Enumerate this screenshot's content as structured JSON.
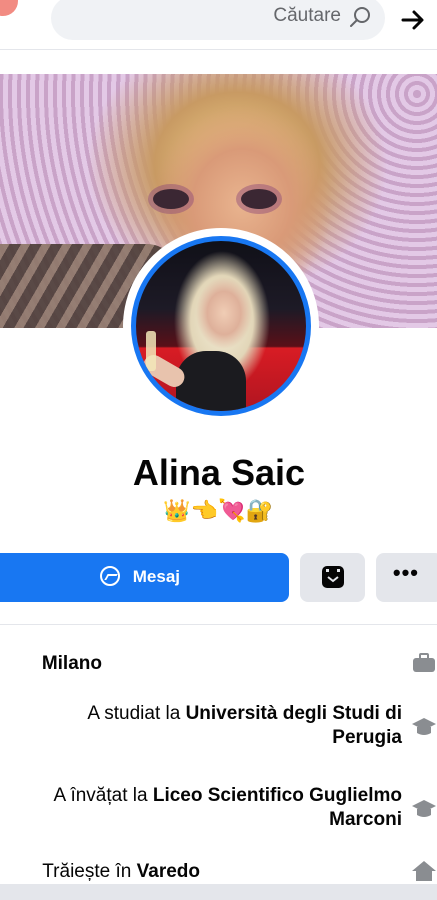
{
  "search": {
    "placeholder": "Căutare"
  },
  "profile": {
    "name": "Alina Saic",
    "bio_emojis": "👑👈💘🔐"
  },
  "actions": {
    "message_label": "Mesaj",
    "more_label": "•••"
  },
  "details": [
    {
      "icon": "briefcase-icon",
      "prefix": "",
      "bold": "Milano"
    },
    {
      "icon": "graduation-cap-icon",
      "prefix": "A studiat la ",
      "bold": "Università degli Studi di Perugia"
    },
    {
      "icon": "graduation-cap-icon",
      "prefix": "A învățat la ",
      "bold": "Liceo Scientifico Guglielmo Marconi"
    },
    {
      "icon": "home-icon",
      "prefix": "Trăiește în ",
      "bold": "Varedo"
    }
  ],
  "colors": {
    "accent": "#1877f2",
    "button_grey": "#e4e6eb",
    "avatar_ring": "#1877f2"
  }
}
